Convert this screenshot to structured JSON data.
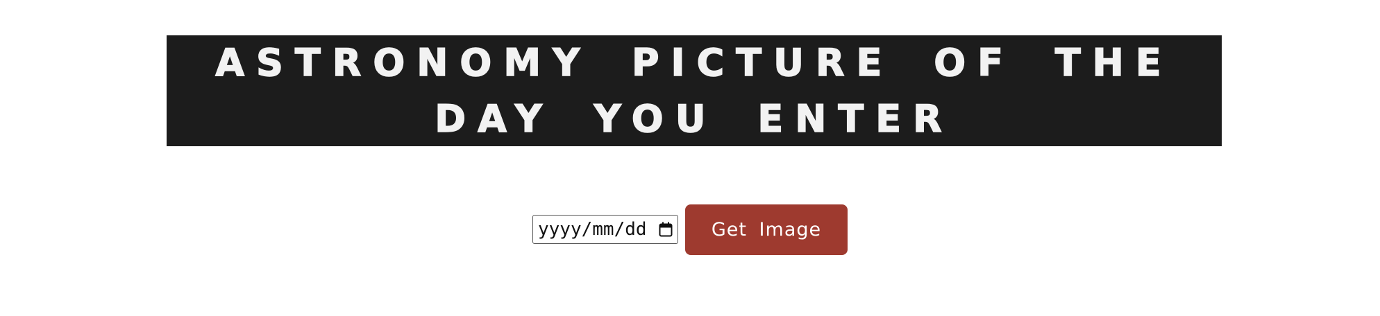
{
  "header": {
    "title": "ASTRONOMY PICTURE OF THE DAY YOU ENTER"
  },
  "form": {
    "date_placeholder": "yyyy/mm/dd",
    "calendar_icon": "calendar-icon",
    "submit_label": "Get Image"
  },
  "colors": {
    "banner_background": "#1c1c1c",
    "banner_text": "#f2f2f2",
    "button_background": "#9e3a2f",
    "button_text": "#ffffff"
  }
}
